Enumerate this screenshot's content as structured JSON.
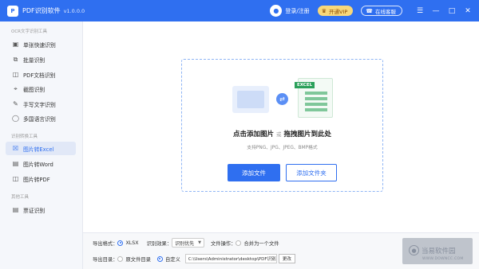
{
  "titlebar": {
    "app_title": "PDF识别软件",
    "version": "v1.0.0.0",
    "login": "登录/注册",
    "vip": "开通VIP",
    "service": "在线客服",
    "icons": [
      "user-icon",
      "crown-icon",
      "headset-icon",
      "menu-icon",
      "minimize-icon",
      "maximize-icon",
      "close-icon"
    ]
  },
  "sidebar": {
    "section1": "OCR文字识别工具",
    "section2": "识别转换工具",
    "section3": "其他工具",
    "items": [
      {
        "label": "单张快速识别",
        "icon": "image-icon"
      },
      {
        "label": "批量识别",
        "icon": "copy-icon"
      },
      {
        "label": "PDF文档识别",
        "icon": "pdf-icon"
      },
      {
        "label": "截图识别",
        "icon": "crop-icon"
      },
      {
        "label": "手写文字识别",
        "icon": "pen-icon"
      },
      {
        "label": "多国语言识别",
        "icon": "globe-icon"
      },
      {
        "label": "图片转Excel",
        "icon": "excel-icon"
      },
      {
        "label": "图片转Word",
        "icon": "word-icon"
      },
      {
        "label": "图片转PDF",
        "icon": "pdf-icon"
      },
      {
        "label": "票证识别",
        "icon": "ticket-icon"
      }
    ]
  },
  "dropzone": {
    "excel_tag": "EXCEL",
    "title_a": "点击添加图片",
    "or": "或",
    "title_b": "拖拽图片到此处",
    "subtitle": "支持PNG、JPG、JPEG、BMP格式",
    "add_file": "添加文件",
    "add_folder": "添加文件夹"
  },
  "bottom": {
    "format_label": "导出格式：",
    "format_value": "XLSX",
    "effect_label": "识别效果：",
    "effect_value": "识别优先",
    "fileop_label": "文件操作：",
    "merge_label": "合并为一个文件",
    "dir_label": "导出目录：",
    "dir_original": "原文件目录",
    "dir_custom": "自定义",
    "path_value": "C:\\Users\\Administrator\\desktop\\PDF识别软",
    "change": "更改"
  },
  "watermark": {
    "text": "当易软件园",
    "sub": "WWW.DOWNCC.COM"
  }
}
